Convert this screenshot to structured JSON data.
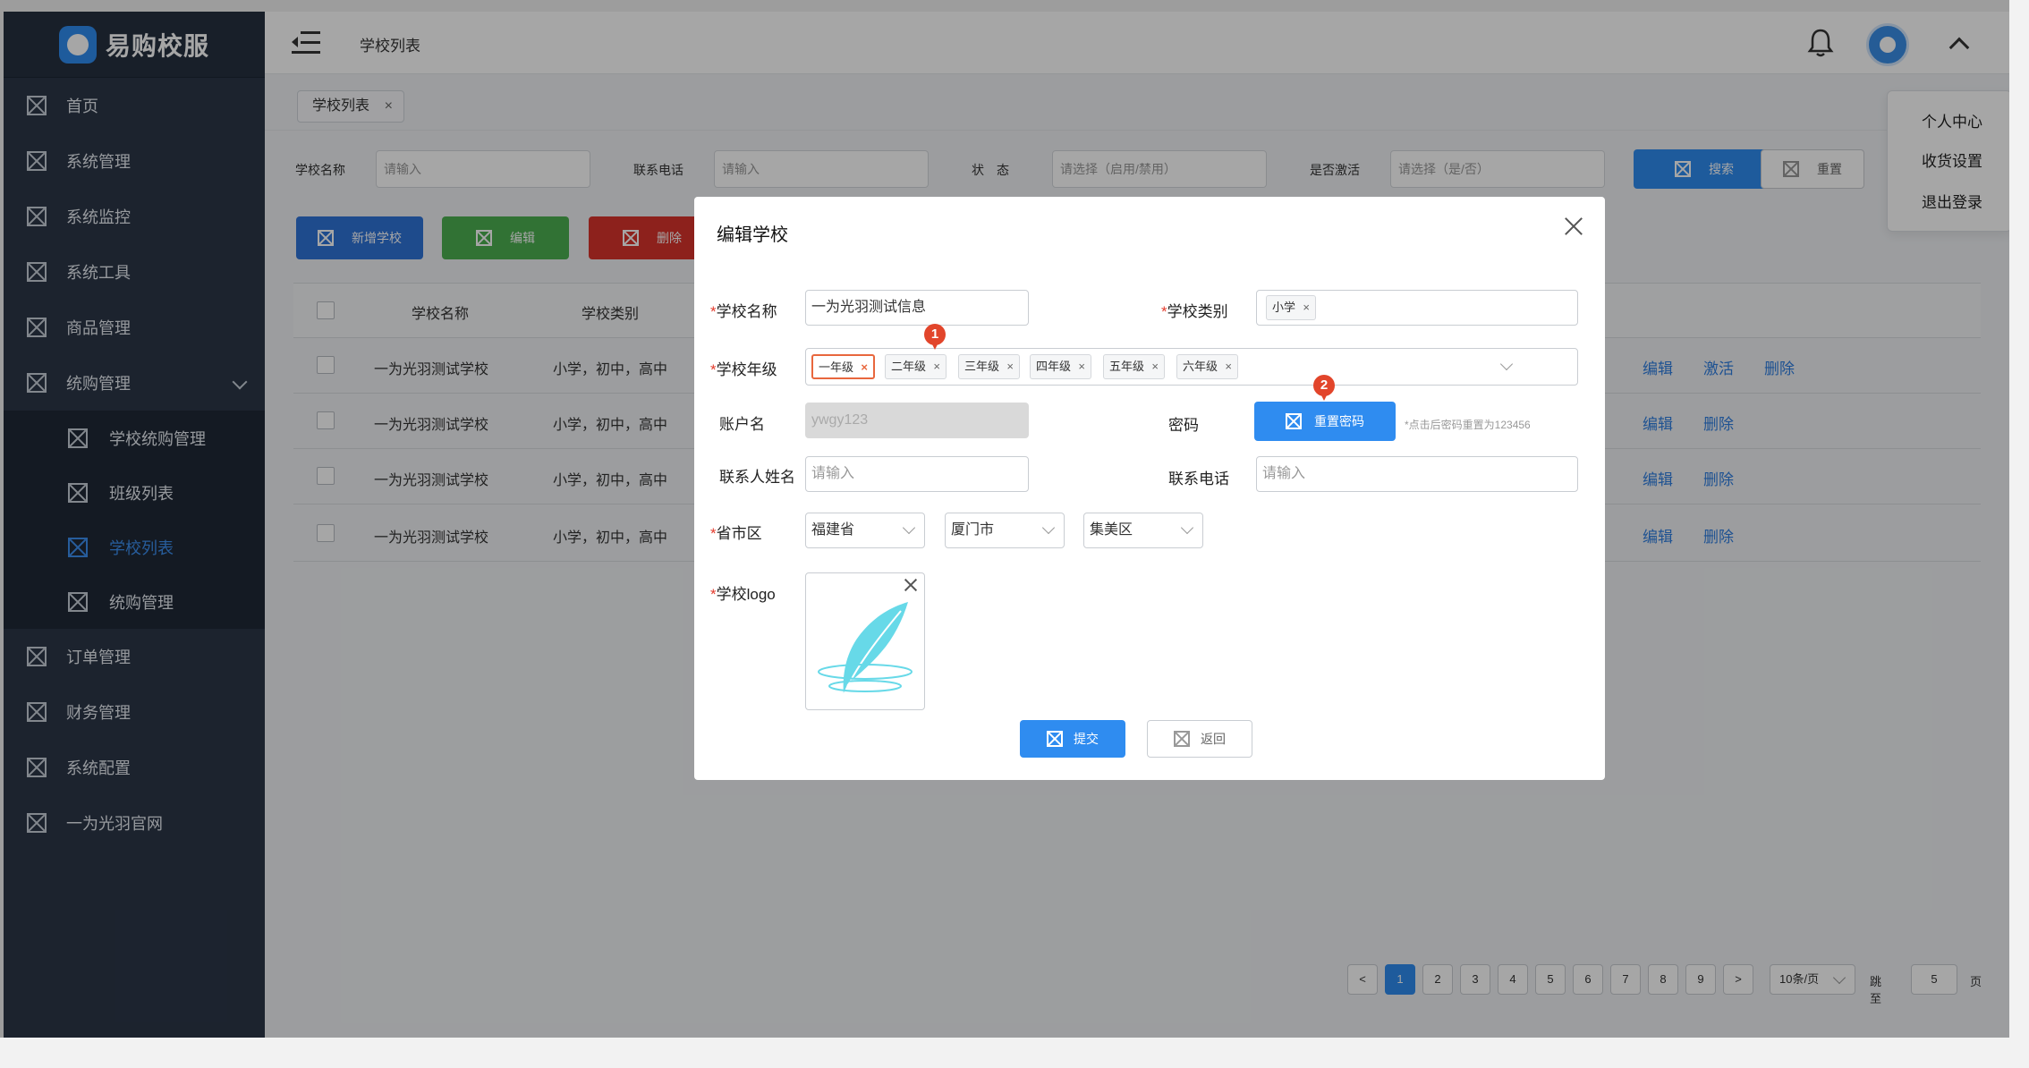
{
  "brand": {
    "name": "易购校服"
  },
  "sidebar": {
    "items": [
      {
        "label": "首页"
      },
      {
        "label": "系统管理"
      },
      {
        "label": "系统监控"
      },
      {
        "label": "系统工具"
      },
      {
        "label": "商品管理"
      },
      {
        "label": "统购管理"
      },
      {
        "label": "订单管理"
      },
      {
        "label": "财务管理"
      },
      {
        "label": "系统配置"
      },
      {
        "label": "一为光羽官网"
      }
    ],
    "sub_items": [
      {
        "label": "学校统购管理"
      },
      {
        "label": "班级列表"
      },
      {
        "label": "学校列表",
        "active": true
      },
      {
        "label": "统购管理"
      }
    ]
  },
  "header": {
    "title": "学校列表"
  },
  "tabs": {
    "active": "学校列表"
  },
  "user_menu": {
    "items": [
      "个人中心",
      "收货设置",
      "退出登录"
    ]
  },
  "filters": {
    "school_name": {
      "label": "学校名称",
      "placeholder": "请输入"
    },
    "phone": {
      "label": "联系电话",
      "placeholder": "请输入"
    },
    "status": {
      "label": "状　态",
      "placeholder": "请选择（启用/禁用）"
    },
    "activated": {
      "label": "是否激活",
      "placeholder": "请选择（是/否）"
    },
    "search_btn": "搜索",
    "reset_btn": "重置"
  },
  "toolbar": {
    "add": "新增学校",
    "edit": "编辑",
    "delete": "删除"
  },
  "table": {
    "columns": [
      "学校名称",
      "学校类别"
    ],
    "rows": [
      {
        "name": "一为光羽测试学校",
        "type": "小学，初中，高中",
        "actions": [
          "编辑",
          "激活",
          "删除"
        ]
      },
      {
        "name": "一为光羽测试学校",
        "type": "小学，初中，高中",
        "actions": [
          "编辑",
          "删除"
        ]
      },
      {
        "name": "一为光羽测试学校",
        "type": "小学，初中，高中",
        "actions": [
          "编辑",
          "删除"
        ]
      },
      {
        "name": "一为光羽测试学校",
        "type": "小学，初中，高中",
        "actions": [
          "编辑",
          "删除"
        ]
      }
    ]
  },
  "pagination": {
    "prev": "<",
    "next": ">",
    "pages": [
      "1",
      "2",
      "3",
      "4",
      "5",
      "6",
      "7",
      "8",
      "9"
    ],
    "current": "1",
    "page_size": "10条/页",
    "jump_label": "跳至",
    "jump_value": "5",
    "jump_suffix": "页"
  },
  "modal": {
    "title": "编辑学校",
    "required_mark": "*",
    "school_name": {
      "label": "学校名称",
      "value": "一为光羽测试信息"
    },
    "school_type": {
      "label": "学校类别",
      "tags": [
        "小学"
      ]
    },
    "grades": {
      "label": "学校年级",
      "tags": [
        "一年级",
        "二年级",
        "三年级",
        "四年级",
        "五年级",
        "六年级"
      ]
    },
    "account": {
      "label": "账户名",
      "value": "ywgy123"
    },
    "password": {
      "label": "密码",
      "button": "重置密码",
      "hint": "*点击后密码重置为123456"
    },
    "contact_name": {
      "label": "联系人姓名",
      "placeholder": "请输入"
    },
    "contact_phone": {
      "label": "联系电话",
      "placeholder": "请输入"
    },
    "region": {
      "label": "省市区",
      "province": "福建省",
      "city": "厦门市",
      "district": "集美区"
    },
    "logo": {
      "label": "学校logo"
    },
    "submit": "提交",
    "back": "返回",
    "markers": [
      "1",
      "2"
    ]
  },
  "colors": {
    "primary": "#2f8cf0",
    "success": "#4caf50",
    "danger": "#d9342b",
    "sidebar": "#2b3648",
    "marker": "#e2452b"
  }
}
